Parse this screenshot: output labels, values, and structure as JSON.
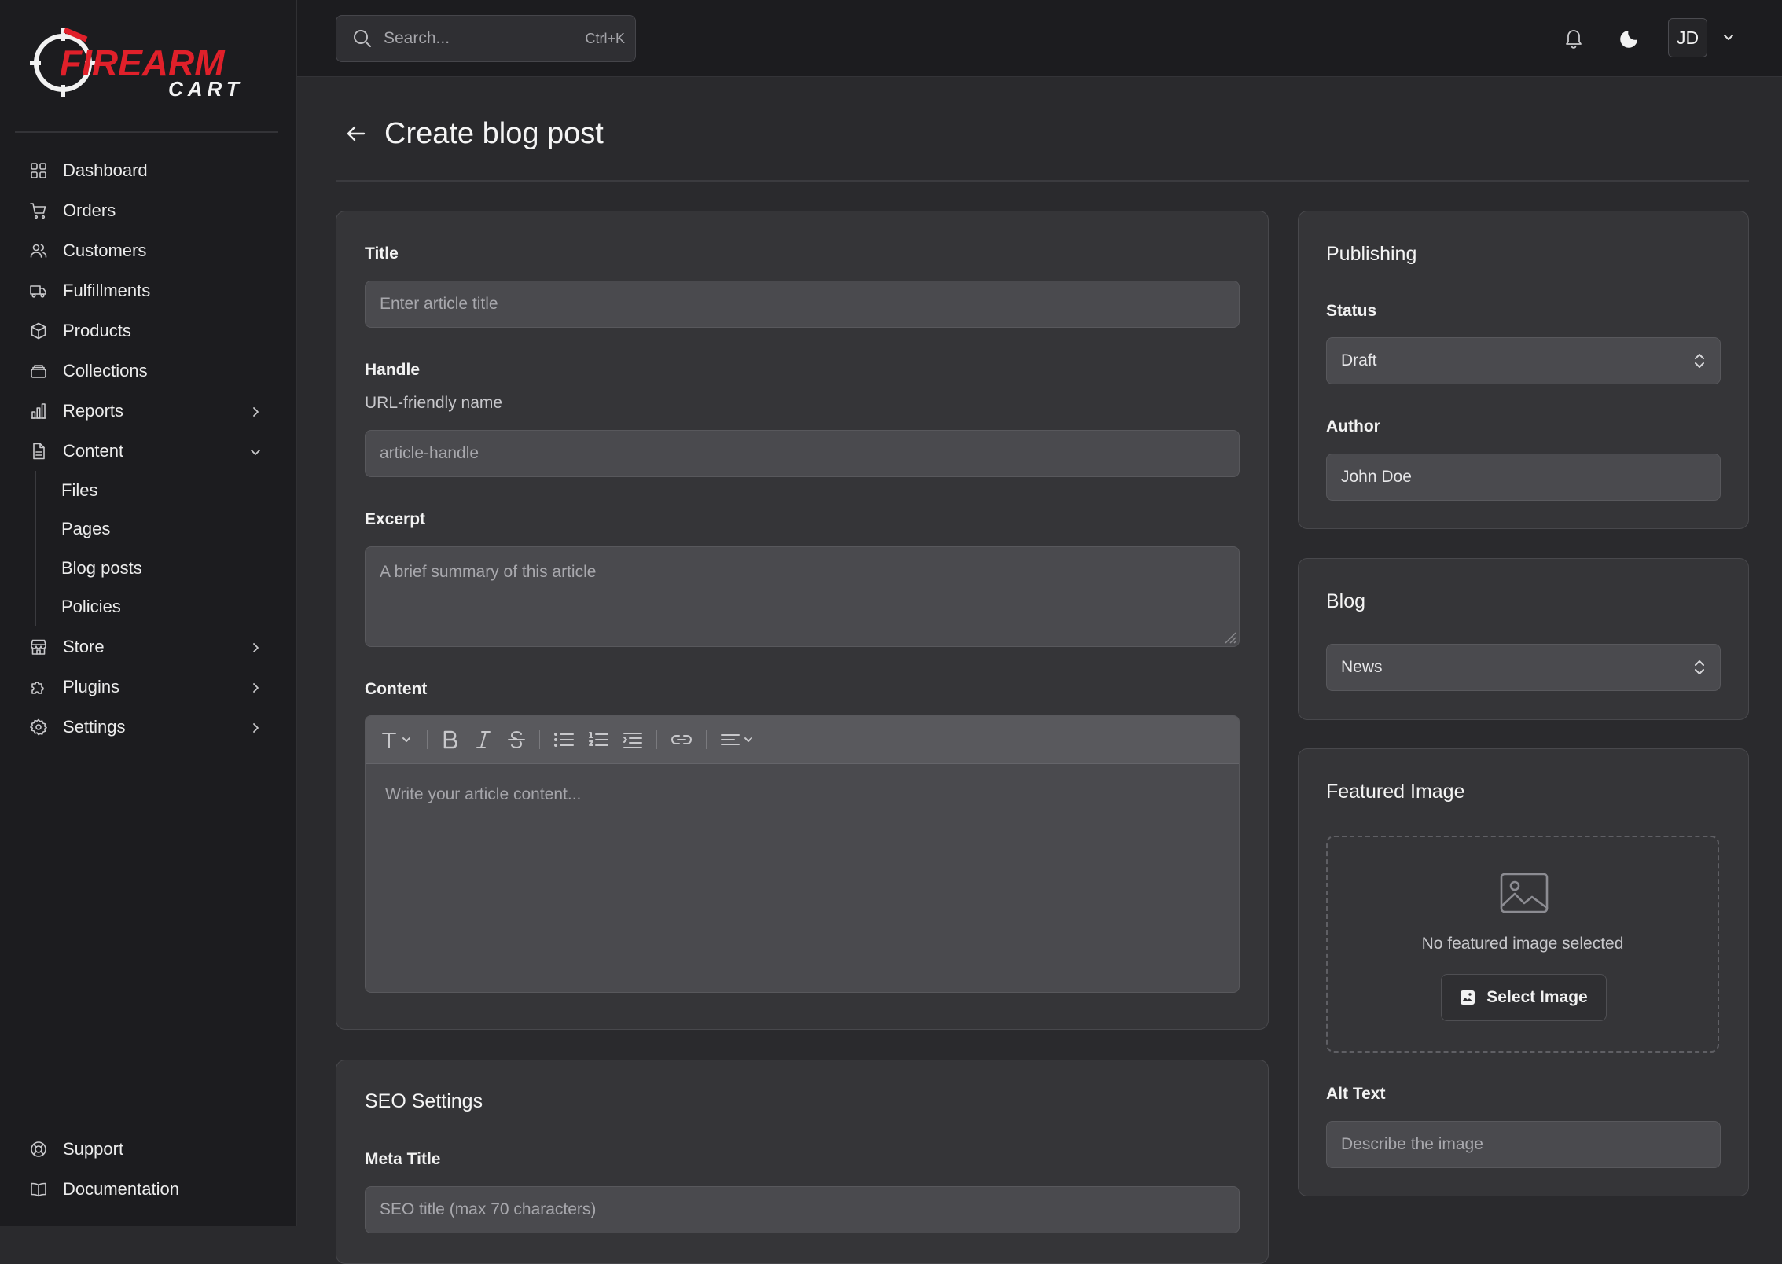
{
  "brand": {
    "name": "FIREARM",
    "tagline": "CART",
    "accent_color": "#e0202a"
  },
  "sidebar": {
    "items": [
      {
        "label": "Dashboard",
        "icon": "dashboard-icon"
      },
      {
        "label": "Orders",
        "icon": "cart-icon"
      },
      {
        "label": "Customers",
        "icon": "users-icon"
      },
      {
        "label": "Fulfillments",
        "icon": "truck-icon"
      },
      {
        "label": "Products",
        "icon": "box-icon"
      },
      {
        "label": "Collections",
        "icon": "collection-icon"
      },
      {
        "label": "Reports",
        "icon": "bar-chart-icon",
        "expandable": true
      },
      {
        "label": "Content",
        "icon": "document-icon",
        "expanded": true
      }
    ],
    "content_children": [
      "Files",
      "Pages",
      "Blog posts",
      "Policies"
    ],
    "items_after": [
      {
        "label": "Store",
        "icon": "store-icon"
      },
      {
        "label": "Plugins",
        "icon": "puzzle-icon"
      },
      {
        "label": "Settings",
        "icon": "gear-icon"
      }
    ],
    "bottom": [
      {
        "label": "Support",
        "icon": "lifebuoy-icon"
      },
      {
        "label": "Documentation",
        "icon": "book-icon"
      }
    ]
  },
  "topbar": {
    "search_placeholder": "Search...",
    "search_shortcut": "Ctrl+K",
    "avatar_initials": "JD"
  },
  "page": {
    "title": "Create blog post"
  },
  "form": {
    "title_label": "Title",
    "title_placeholder": "Enter article title",
    "handle_label": "Handle",
    "handle_helper": "URL-friendly name",
    "handle_placeholder": "article-handle",
    "excerpt_label": "Excerpt",
    "excerpt_placeholder": "A brief summary of this article",
    "content_label": "Content",
    "content_placeholder": "Write your article content..."
  },
  "seo": {
    "title": "SEO Settings",
    "meta_title_label": "Meta Title",
    "meta_title_placeholder": "SEO title (max 70 characters)"
  },
  "publishing": {
    "title": "Publishing",
    "status_label": "Status",
    "status_value": "Draft",
    "author_label": "Author",
    "author_value": "John Doe"
  },
  "blog": {
    "title": "Blog",
    "value": "News"
  },
  "featured_image": {
    "title": "Featured Image",
    "empty_text": "No featured image selected",
    "select_label": "Select Image",
    "alt_label": "Alt Text",
    "alt_placeholder": "Describe the image"
  }
}
